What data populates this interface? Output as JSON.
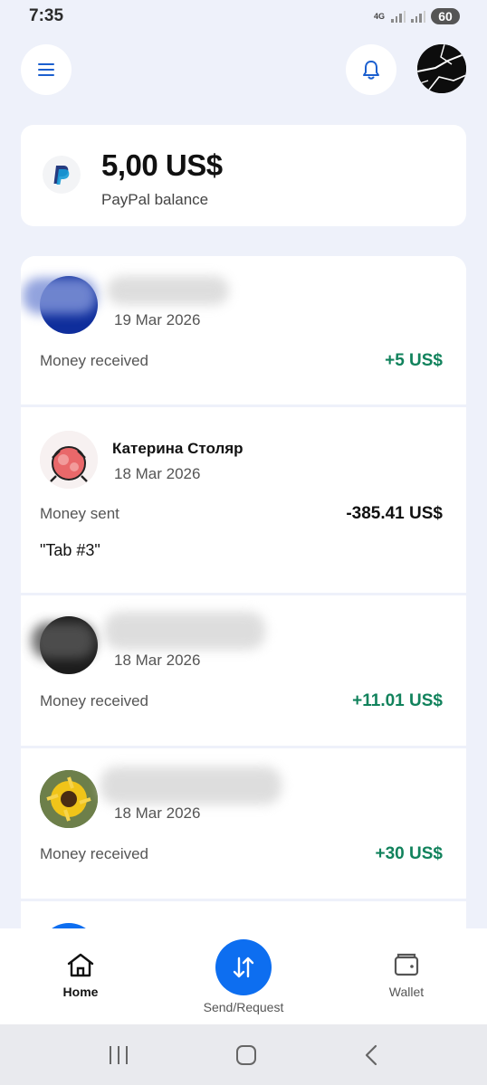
{
  "status_bar": {
    "time": "7:35",
    "network": "4G",
    "battery": "60"
  },
  "header": {
    "menu_icon": "hamburger-icon",
    "bell_icon": "bell-icon"
  },
  "balance": {
    "amount": "5,00 US$",
    "label": "PayPal balance"
  },
  "transactions": [
    {
      "name": "",
      "date": "19 Mar 2026",
      "type": "Money received",
      "amount": "+5 US$",
      "direction": "in"
    },
    {
      "name": "Катерина Столяр",
      "date": "18 Mar 2026",
      "type": "Money sent",
      "amount": "-385.41 US$",
      "note": "\"Tab #3\"",
      "direction": "out"
    },
    {
      "name": "",
      "date": "18 Mar 2026",
      "type": "Money received",
      "amount": "+11.01 US$",
      "direction": "in"
    },
    {
      "name": "",
      "date": "18 Mar 2026",
      "type": "Money received",
      "amount": "+30 US$",
      "direction": "in"
    }
  ],
  "bottom_nav": {
    "home": "Home",
    "send_request": "Send/Request",
    "wallet": "Wallet"
  },
  "colors": {
    "accent": "#0d6ef0",
    "positive": "#11825c",
    "background": "#eef1fa"
  }
}
